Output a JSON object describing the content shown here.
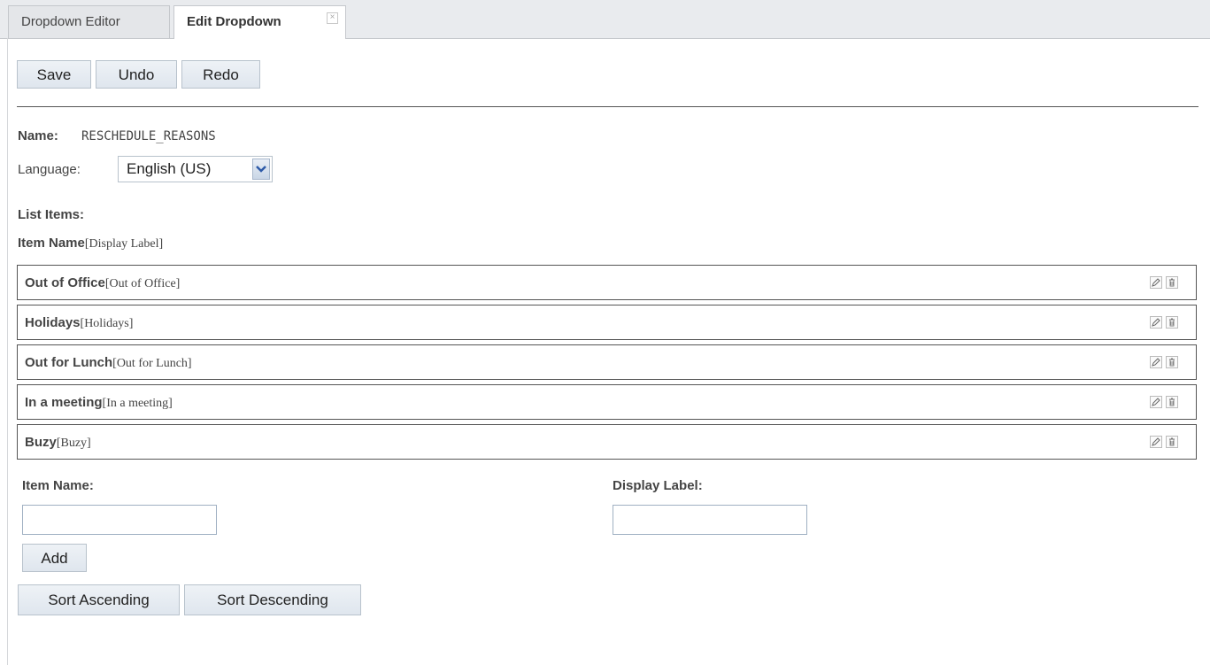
{
  "tabs": [
    {
      "label": "Dropdown Editor"
    },
    {
      "label": "Edit Dropdown"
    }
  ],
  "toolbar": {
    "save_label": "Save",
    "undo_label": "Undo",
    "redo_label": "Redo"
  },
  "form": {
    "name_label": "Name:",
    "name_value": "RESCHEDULE_REASONS",
    "language_label": "Language:",
    "language_value": "English (US)",
    "list_items_label": "List Items:",
    "item_header_bold": "Item Name",
    "item_header_serif": "[Display Label]"
  },
  "items": [
    {
      "name": "Out of Office",
      "label": "[Out of Office]"
    },
    {
      "name": "Holidays",
      "label": "[Holidays]"
    },
    {
      "name": "Out for Lunch",
      "label": "[Out for Lunch]"
    },
    {
      "name": "In a meeting",
      "label": "[In a meeting]"
    },
    {
      "name": "Buzy",
      "label": "[Buzy]"
    }
  ],
  "add_form": {
    "item_name_label": "Item Name:",
    "item_name_value": "",
    "display_label_label": "Display Label:",
    "display_label_value": "",
    "add_label": "Add"
  },
  "sort": {
    "ascending_label": "Sort Ascending",
    "descending_label": "Sort Descending"
  },
  "icons": {
    "edit": "pencil-icon",
    "delete": "trash-icon",
    "close": "close-icon",
    "dropdown": "chevron-down-icon"
  },
  "colors": {
    "row_border": "#555555",
    "button_bg": "#e4eaf1",
    "tab_bar": "#e9ebee"
  }
}
